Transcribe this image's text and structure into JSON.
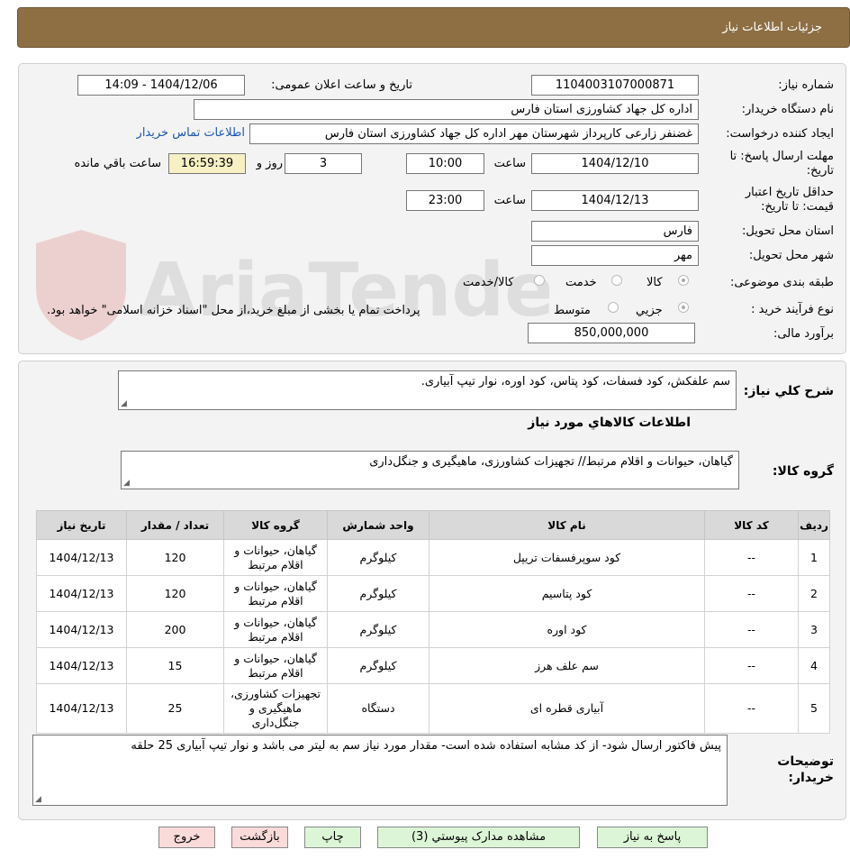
{
  "header": {
    "title": "جزئیات اطلاعات نیاز"
  },
  "labels": {
    "need_number": "شماره نیاز:",
    "announce_datetime": "تاریخ و ساعت اعلان عمومی:",
    "buyer_org": "نام دستگاه خریدار:",
    "requester": "ایجاد کننده درخواست:",
    "contact_link": "اطلاعات تماس خریدار",
    "reply_deadline": "مهلت ارسال پاسخ: تا تاریخ:",
    "time": "ساعت",
    "day_and": "روز و",
    "remaining": "ساعت باقي مانده",
    "price_validity": "حداقل تاریخ اعتبار قیمت: تا تاریخ:",
    "time2": "ساعت",
    "province": "استان محل تحویل:",
    "city": "شهر محل تحویل:",
    "category": "طبقه بندی موضوعی:",
    "purchase_type": "نوع فرآیند خرید :",
    "budget": "برآورد مالی:",
    "description": "شرح کلي نیاز:",
    "goods_info": "اطلاعات کالاهاي مورد نیاز",
    "goods_group": "گروه کالا:",
    "buyer_notes": "توضیحات خریدار:"
  },
  "values": {
    "need_number": "1104003107000871",
    "announce_datetime": "1404/12/06 - 14:09",
    "buyer_org": "اداره کل جهاد کشاورزی استان فارس",
    "requester": "غضنفر زارعی  کارپرداز شهرستان مهر اداره کل جهاد کشاورزی استان فارس",
    "reply_date": "1404/12/10",
    "reply_time": "10:00",
    "days": "3",
    "remaining_time": "16:59:39",
    "validity_date": "1404/12/13",
    "validity_time": "23:00",
    "province": "فارس",
    "city": "مهر",
    "budget": "850,000,000",
    "description": "سم علفکش، کود فسفات، کود پتاس، کود اوره، نوار تیپ آبیاری.",
    "goods_group": "گیاهان، حیوانات و اقلام مرتبط// تجهیزات کشاورزی، ماهیگیری و جنگل‌داری",
    "buyer_notes": "پیش فاکتور ارسال شود- از کد مشابه استفاده شده است- مقدار مورد نیاز سم به لیتر می باشد و نوار تیپ آبیاری 25 حلقه"
  },
  "category_options": [
    "کالا",
    "خدمت",
    "کالا/خدمت"
  ],
  "category_selected": "کالا",
  "purchase_options": [
    "جزیي",
    "متوسط"
  ],
  "purchase_selected": "جزیي",
  "purchase_note": "پرداخت تمام یا بخشی از مبلغ خرید،از محل \"اسناد خزانه اسلامی\" خواهد بود.",
  "watermark": "AriaTender.neT",
  "table": {
    "headers": [
      "ردیف",
      "کد کالا",
      "نام کالا",
      "واحد شمارش",
      "گروه کالا",
      "تعداد / مقدار",
      "تاریخ نیاز"
    ],
    "rows": [
      {
        "idx": "1",
        "code": "--",
        "name": "کود سوپرفسفات تریپل",
        "unit": "کیلوگرم",
        "group": "گیاهان، حیوانات و اقلام مرتبط",
        "qty": "120",
        "date": "1404/12/13"
      },
      {
        "idx": "2",
        "code": "--",
        "name": "کود پتاسیم",
        "unit": "کیلوگرم",
        "group": "گیاهان، حیوانات و اقلام مرتبط",
        "qty": "120",
        "date": "1404/12/13"
      },
      {
        "idx": "3",
        "code": "--",
        "name": "کود اوره",
        "unit": "کیلوگرم",
        "group": "گیاهان، حیوانات و اقلام مرتبط",
        "qty": "200",
        "date": "1404/12/13"
      },
      {
        "idx": "4",
        "code": "--",
        "name": "سم علف هرز",
        "unit": "کیلوگرم",
        "group": "گیاهان، حیوانات و اقلام مرتبط",
        "qty": "15",
        "date": "1404/12/13"
      },
      {
        "idx": "5",
        "code": "--",
        "name": "آبیاری قطره ای",
        "unit": "دستگاه",
        "group": "تجهیزات کشاورزی، ماهیگیری و جنگل‌داری",
        "qty": "25",
        "date": "1404/12/13"
      }
    ]
  },
  "buttons": {
    "reply": "پاسخ به نیاز",
    "attachments": "مشاهده مدارک پیوستي (3)",
    "print": "چاپ",
    "back": "بازگشت",
    "exit": "خروج"
  }
}
